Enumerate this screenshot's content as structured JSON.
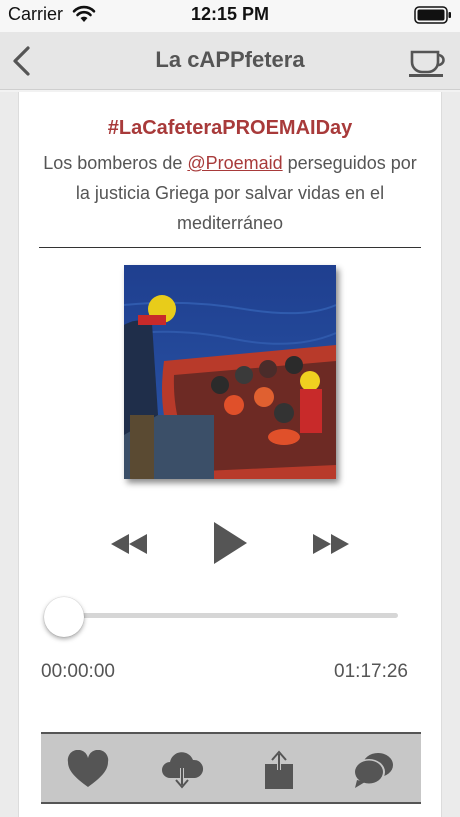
{
  "status_bar": {
    "carrier": "Carrier",
    "time": "12:15 PM",
    "wifi_icon": "wifi-icon",
    "battery_icon": "battery-icon"
  },
  "nav": {
    "title": "La cAPPfetera",
    "back_icon": "chevron-left-icon",
    "right_icon": "coffee-cup-icon"
  },
  "episode": {
    "hashtag": "#LaCafeteraPROEMAIDay",
    "desc_before": "Los bomberos de ",
    "mention": "@Proemaid",
    "desc_after": " perseguidos por la justicia Griega por salvar vidas en el mediterráneo"
  },
  "player": {
    "progress": 0.0,
    "elapsed": "00:00:00",
    "total": "01:17:26"
  },
  "toolbar": {
    "items": [
      "heart-icon",
      "cloud-download-icon",
      "share-icon",
      "chat-bubbles-icon"
    ]
  },
  "colors": {
    "accent": "#a83a3a",
    "text": "#555555",
    "icon": "#555555",
    "toolbar_bg": "#c7c7c7"
  }
}
